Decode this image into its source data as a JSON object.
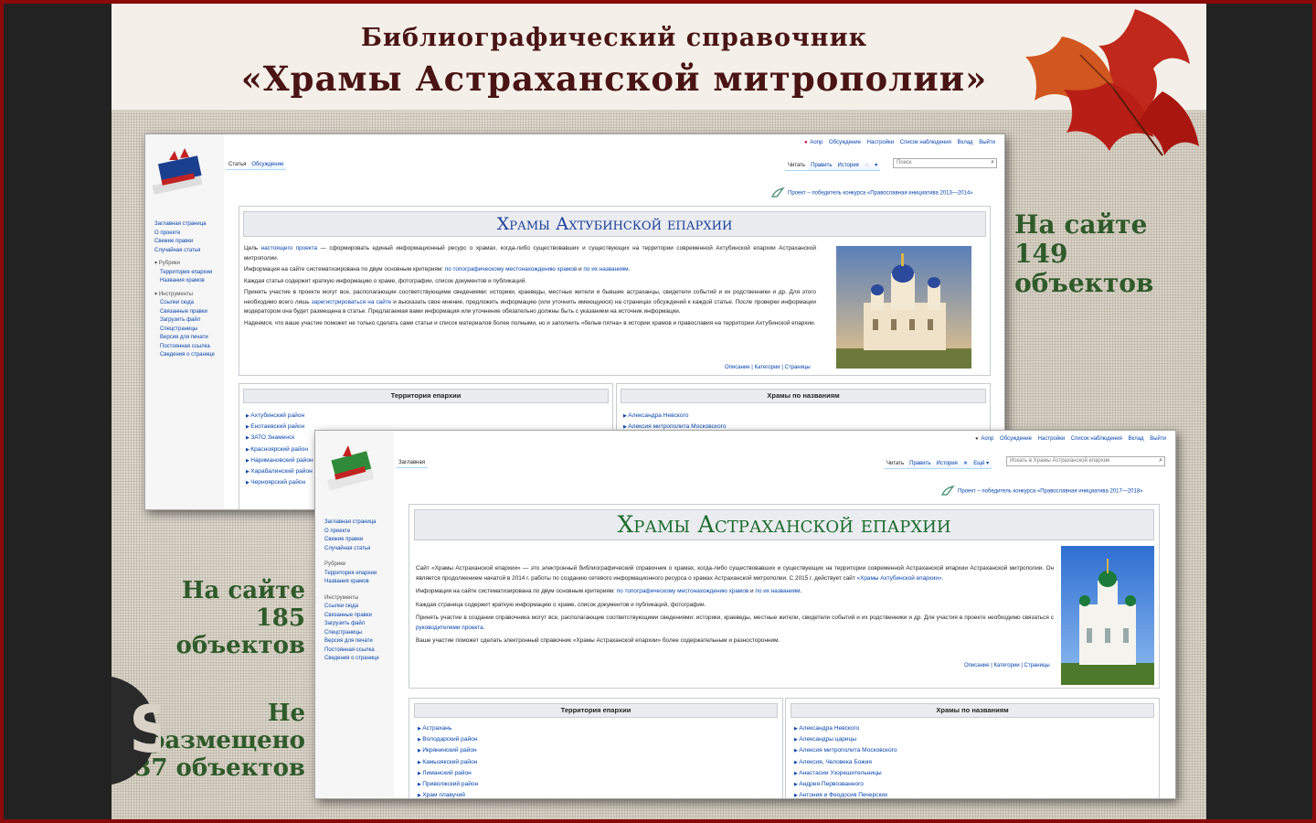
{
  "slide": {
    "title_line1": "Библиографический справочник",
    "title_line2": "«Храмы Астраханской митрополии»",
    "stat_top": "На сайте\n149\nобъектов",
    "stat_mid": "На сайте\n185\nобъектов",
    "stat_bottom": "Не\nразмещено\n37 объектов",
    "colors": {
      "title": "#4a1414",
      "stat": "#2f5a2a",
      "frame": "#8a0a0a"
    }
  },
  "wiki1": {
    "userbar": [
      "Аоnр",
      "Обсуждение",
      "Настройки",
      "Список наблюдения",
      "Вклад",
      "Выйти"
    ],
    "tabs_left": [
      "Статья",
      "Обсуждение"
    ],
    "tabs_right": [
      "Читать",
      "Править",
      "История"
    ],
    "search_placeholder": "Поиск",
    "project_text": "Проект – победитель конкурса «Православная инициатива 2013—2014»",
    "heading": "Храмы Ахтубинской епархии",
    "portal": {
      "main": [
        "Заглавная страница",
        "О проекте",
        "Свежие правки",
        "Случайная статья"
      ],
      "rubrics_head": "Рубрики",
      "rubrics": [
        "Территория епархии",
        "Названия храмов"
      ],
      "tools_head": "Инструменты",
      "tools": [
        "Ссылки сюда",
        "Связанные правки",
        "Загрузить файл",
        "Спецстраницы",
        "Версия для печати",
        "Постоянная ссылка",
        "Сведения о странице"
      ]
    },
    "p1_a": "Цель ",
    "p1_link": "настоящего проекта",
    "p1_b": " — сформировать единый информационный ресурс о храмах, когда-либо существовавших и существующих на территории современной Ахтубинской епархии Астраханской митрополии.",
    "p2_a": "Информация на сайте систематизирована по двум основным критериям: ",
    "p2_link1": "по топографическому местонахождению храмов",
    "p2_b": " и ",
    "p2_link2": "по их названиям",
    "p2_c": ".",
    "p3": "Каждая статья содержит краткую информацию о храме, фотографии, список документов и публикаций.",
    "p4_a": "Принять участие в проекте могут все, располагающие соответствующими сведениями: историки, краеведы, местные жители и бывшие астраханцы, свидетели событий и их родственники и др. Для этого необходимо всего лишь ",
    "p4_link": "зарегистрироваться на сайте",
    "p4_b": " и высказать свое мнение, предложить информацию (или уточнить имеющуюся) на страницах обсуждений к каждой статье. После проверки информации модератором она будет размещена в статье. Предлагаемая вами информация или уточнение обязательно должны быть с указанием на источник информации.",
    "p5": "Надеемся, что ваше участие поможет не только сделать сами статьи и список материалов более полными, но и заполнить «белые пятна» в истории храмов и православия на территории Ахтубинской епархии.",
    "catline": "Описание | Категории | Страницы",
    "sec_left": "Территория епархии",
    "sec_right": "Храмы по названиям",
    "list_left": [
      "Ахтубинский район",
      "Енотаевский район",
      "ЗАТО Знаменск",
      "Красноярский район",
      "Наримановский район",
      "Харабалинский район",
      "Черноярский район"
    ],
    "list_right": [
      "Александра Невского",
      "Алексия митрополита Московского"
    ]
  },
  "wiki2": {
    "userbar": [
      "Аоnр",
      "Обсуждение",
      "Настройки",
      "Список наблюдения",
      "Вклад",
      "Выйти"
    ],
    "tabs_left": [
      "Заглавная"
    ],
    "tabs_right": [
      "Читать",
      "Править",
      "История",
      "Ещё"
    ],
    "search_placeholder": "Искать в Храмы Астраханской епархии",
    "project_text": "Проект – победитель конкурса «Православная инициатива 2017—2018»",
    "heading": "Храмы Астраханской епархии",
    "portal": {
      "main": [
        "Заглавная страница",
        "О проекте",
        "Свежие правки",
        "Случайная статья"
      ],
      "rubrics_head": "Рубрики",
      "rubrics": [
        "Территория епархии",
        "Названия храмов"
      ],
      "tools_head": "Инструменты",
      "tools": [
        "Ссылки сюда",
        "Связанные правки",
        "Загрузить файл",
        "Спецстраницы",
        "Версия для печати",
        "Постоянная ссылка",
        "Сведения о странице"
      ]
    },
    "p1_a": "Сайт «Храмы Астраханской епархии» — это электронный библиографический справочник о храмах, когда-либо существовавших и существующих на территории современной Астраханской епархии Астраханской митрополии. Он является продолжением начатой в 2014 г. работы по созданию сетевого информационного ресурса о храмах Астраханской митрополии. С 2015 г. действует сайт ",
    "p1_link": "«Храмы Ахтубинской епархии»",
    "p1_b": ".",
    "p2_a": "Информация на сайте систематизирована по двум основным критериям: ",
    "p2_link1": "по топографическому местонахождению храмов",
    "p2_b": " и ",
    "p2_link2": "по их названиям",
    "p2_c": ".",
    "p3": "Каждая страница содержит краткую информацию о храме, список документов и публикаций, фотографии.",
    "p4_a": "Принять участие в создании справочника могут все, располагающие соответствующими сведениями: историки, краеведы, местные жители, свидетели событий и их родственники и др. Для участия в проекте необходимо связаться с ",
    "p4_link": "руководителями проекта",
    "p4_b": ".",
    "p5": "Ваше участие поможет сделать электронный справочник «Храмы Астраханской епархии» более содержательным и разносторонним.",
    "catline": "Описание | Категории | Страницы",
    "sec_left": "Территория епархии",
    "sec_right": "Храмы по названиям",
    "list_left": [
      "Астрахань",
      "Володарский район",
      "Икрянинский район",
      "Камызякский район",
      "Лиманский район",
      "Приволжский район",
      "Храм плавучий"
    ],
    "list_right": [
      "Александра Невского",
      "Александры царицы",
      "Алексия митрополита Московского",
      "Алексия, Человека Божия",
      "Анастасии Узорешительницы",
      "Андрея Первозванного",
      "Антония и Феодосия Печерских"
    ]
  }
}
